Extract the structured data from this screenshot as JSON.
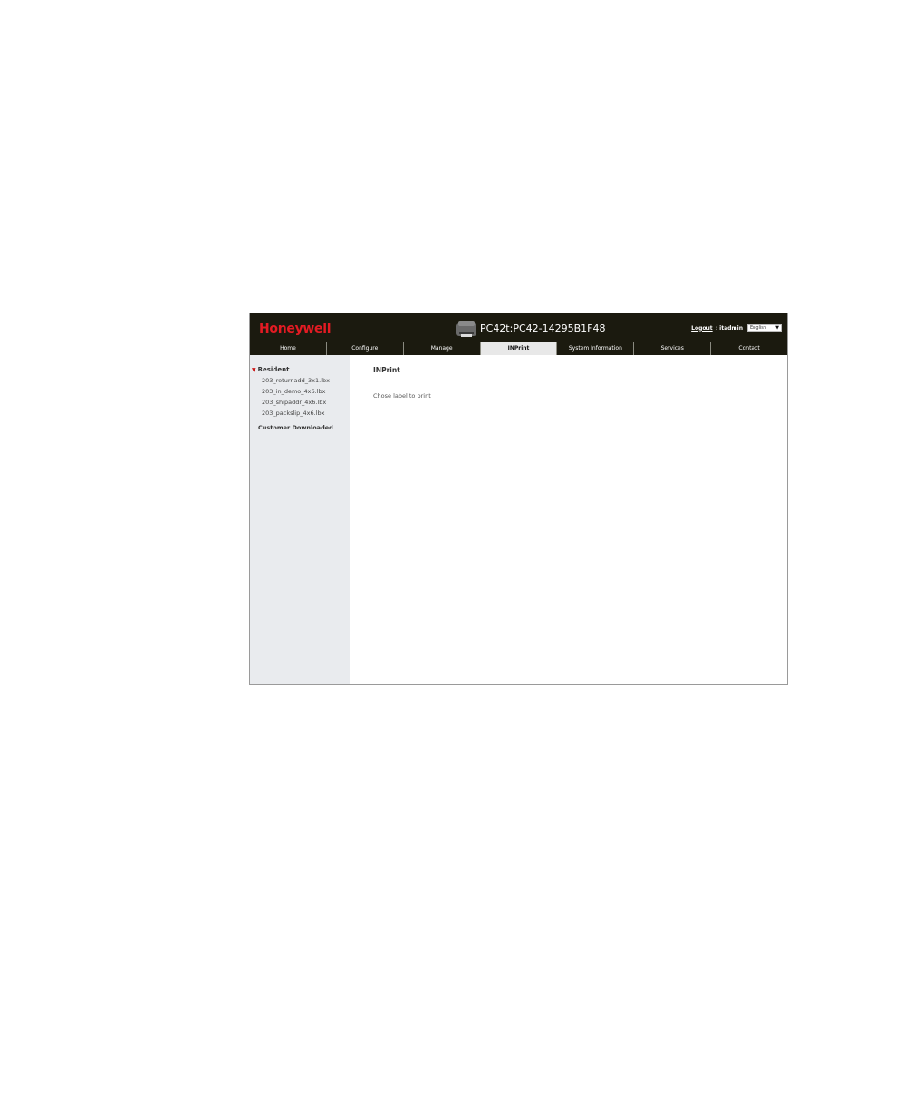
{
  "header": {
    "logo": "Honeywell",
    "device_name": "PC42t:PC42-14295B1F48",
    "logout_label": "Logout",
    "user": ": itadmin",
    "language": "English"
  },
  "tabs": [
    {
      "label": "Home"
    },
    {
      "label": "Configure"
    },
    {
      "label": "Manage"
    },
    {
      "label": "INPrint",
      "active": true
    },
    {
      "label": "System Information"
    },
    {
      "label": "Services"
    },
    {
      "label": "Contact"
    }
  ],
  "sidebar": {
    "resident_title": "Resident",
    "files": [
      "203_returnadd_3x1.lbx",
      "203_in_demo_4x6.lbx",
      "203_shipaddr_4x6.lbx",
      "203_packslip_4x6.lbx"
    ],
    "customer_title": "Customer Downloaded"
  },
  "main": {
    "title": "INPrint",
    "instruction": "Chose label to print"
  },
  "colors": {
    "header_bg": "#1b1a0f",
    "brand_red": "#e31b23",
    "sidebar_bg": "#e9ebee",
    "active_tab_bg": "#e8e8e8"
  }
}
